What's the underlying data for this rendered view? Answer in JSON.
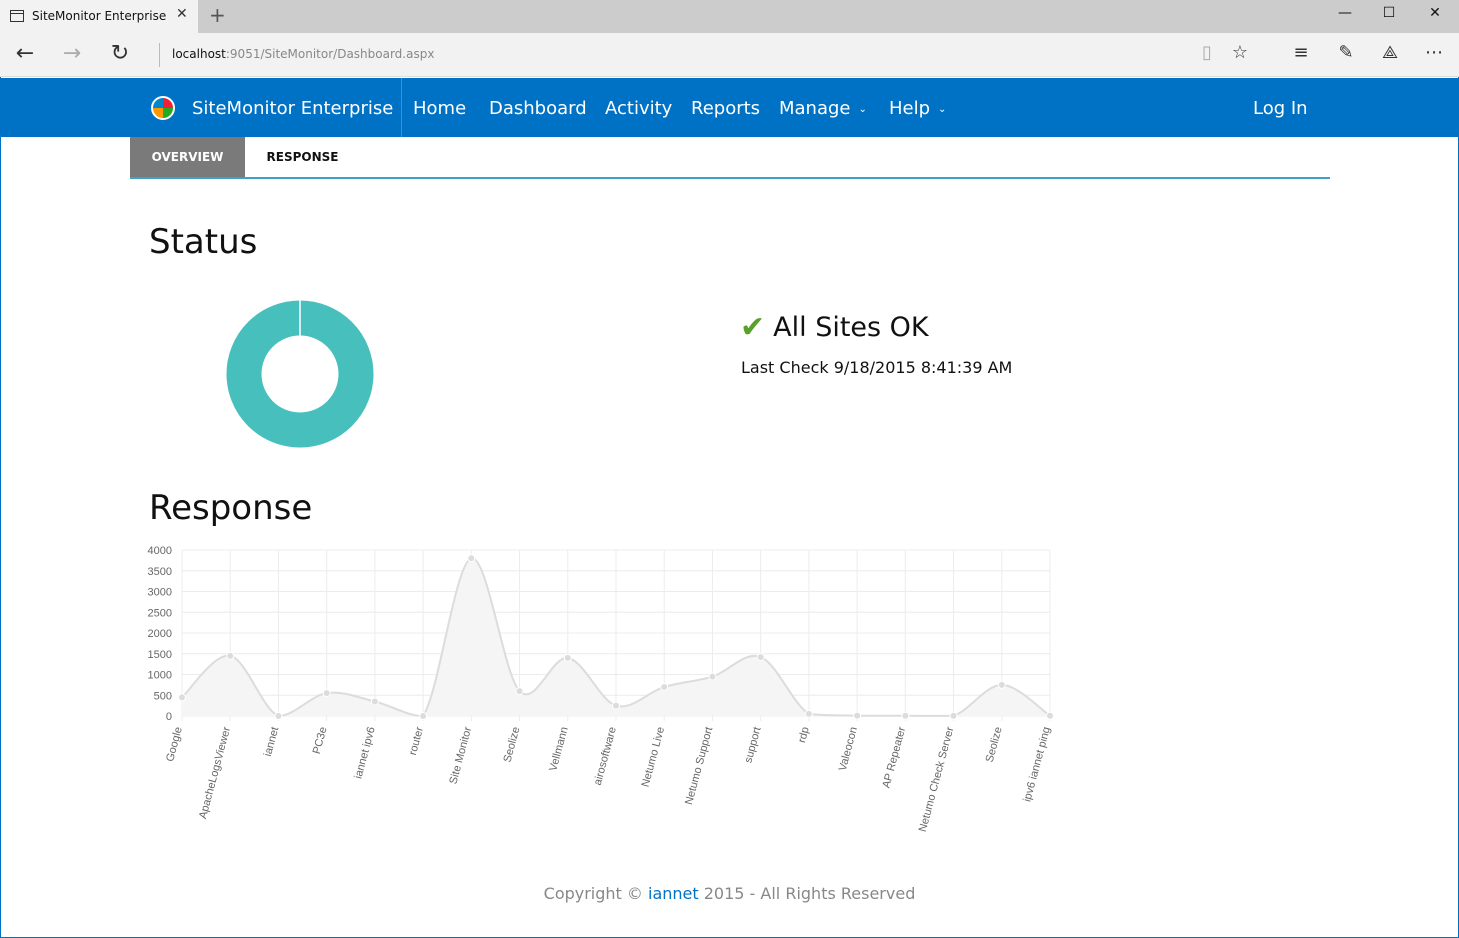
{
  "browser": {
    "tab_title": "SiteMonitor Enterprise",
    "url_host": "localhost",
    "url_rest": ":9051/SiteMonitor/Dashboard.aspx"
  },
  "navbar": {
    "brand": "SiteMonitor Enterprise",
    "links": [
      "Home",
      "Dashboard",
      "Activity",
      "Reports",
      "Manage",
      "Help"
    ],
    "login": "Log In"
  },
  "subtabs": [
    "OVERVIEW",
    "RESPONSE"
  ],
  "status": {
    "heading": "Status",
    "summary": "All Sites OK",
    "last_check": "Last Check 9/18/2015 8:41:39 AM",
    "donut_color": "#46bfbd"
  },
  "response": {
    "heading": "Response"
  },
  "chart_data": {
    "type": "line",
    "categories": [
      "Google",
      "ApacheLogsViewer",
      "iannet",
      "PC3e",
      "iannet ipv6",
      "router",
      "Site Monitor",
      "Seolize",
      "Vellmann",
      "airosoftware",
      "Netumo Live",
      "Netumo Support",
      "support",
      "rdp",
      "Valeocon",
      "AP Repeater",
      "Netumo Check Server",
      "Seolize",
      "ipv6 iannet ping"
    ],
    "values": [
      450,
      1450,
      0,
      550,
      350,
      0,
      3800,
      600,
      1400,
      250,
      700,
      950,
      1420,
      50,
      10,
      5,
      5,
      750,
      5
    ],
    "ylim": [
      0,
      4000
    ],
    "yticks": [
      0,
      500,
      1000,
      1500,
      2000,
      2500,
      3000,
      3500,
      4000
    ],
    "ytick_labels": [
      "0",
      "500",
      "1000",
      "1500",
      "2000",
      "2500",
      "3000",
      "3500",
      "4000"
    ],
    "grid": true,
    "line_color": "#dcdcdc",
    "fill_color": "#f5f5f5"
  },
  "footer": {
    "prefix": "Copyright © ",
    "link": "iannet",
    "suffix": " 2015 - All Rights Reserved"
  }
}
